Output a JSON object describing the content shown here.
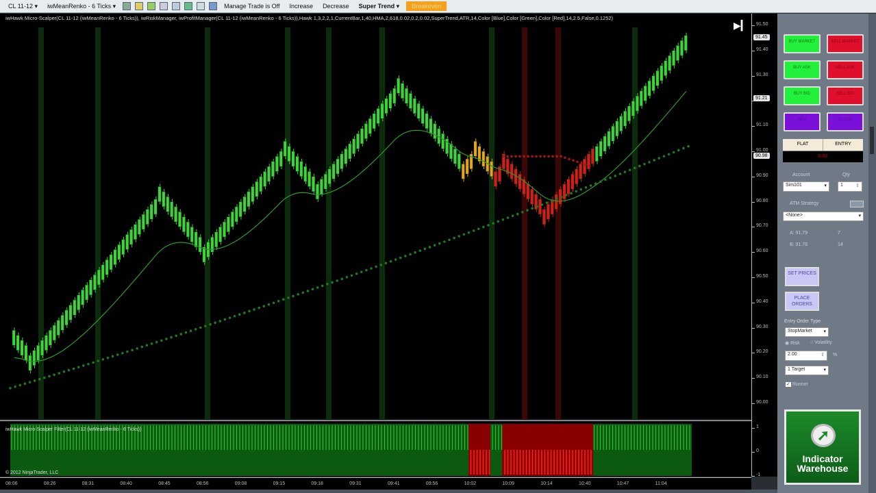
{
  "toolbar": {
    "instrument": "CL 11-12",
    "bar_type": "iwMeanRenko - 6 Ticks",
    "manage_trade": "Manage Trade is Off",
    "increase": "Increase",
    "decrease": "Decrease",
    "strategy": "Super Trend",
    "highlight": "Breakeven"
  },
  "chart": {
    "title": "iwHawk Micro-Scalper(CL 11-12 (iwMeanRenko - 6 Ticks)), iwRiskManager, iwProfitManager(CL 11-12 (iwMeanRenko - 6 Ticks)),Hawk 1,3,2,2,1,CurrentBar,1,40,HMA,2,618,0.02,0.2,0.02,SuperTrend,ATR,14,Color [Blue],Color [Green],Color [Red],14,2.5,False,0.1252)",
    "price_ticks": [
      "91.50",
      "91.40",
      "91.30",
      "91.20",
      "91.10",
      "91.00",
      "90.90",
      "90.80",
      "90.70",
      "90.60",
      "90.50",
      "90.40",
      "90.30",
      "90.20",
      "90.10",
      "90.00"
    ],
    "price_tags": [
      "91.45",
      "91.21",
      "90.98"
    ],
    "lower_ticks": [
      "1",
      "0",
      "-1"
    ]
  },
  "chart_data": {
    "type": "renko",
    "ylim": [
      90.0,
      91.5
    ],
    "brick_step": 0.02,
    "brick_size": 0.06,
    "pivots": [
      90.25,
      90.17,
      90.82,
      90.6,
      91.0,
      90.85,
      91.25,
      90.93,
      91.0,
      90.9,
      90.95,
      90.75,
      91.0,
      91.45
    ],
    "segment_colors": [
      "#3fd43a",
      "#3fd43a",
      "#3fd43a",
      "#3fd43a",
      "#3fd43a",
      "#3fd43a",
      "#3fd43a",
      "#e8a21f",
      "#e8a21f",
      "#e01818",
      "#e01818",
      "#e01818",
      "#3fd43a"
    ],
    "supertrend_start": 90.06,
    "supertrend_end": 91.02,
    "filter": [
      "g",
      "g",
      "g",
      "g",
      "g",
      "g",
      "g",
      "g",
      "g",
      "g",
      "g",
      "g",
      "g",
      "g",
      "g",
      "g",
      "g",
      "g",
      "g",
      "g",
      "g",
      "g",
      "g",
      "g",
      "g",
      "g",
      "g",
      "g",
      "g",
      "g",
      "g",
      "g",
      "g",
      "g",
      "g",
      "g",
      "g",
      "g",
      "g",
      "g",
      "g",
      "g",
      "g",
      "g",
      "g",
      "g",
      "g",
      "g",
      "g",
      "g",
      "g",
      "g",
      "g",
      "g",
      "g",
      "g",
      "g",
      "g",
      "g",
      "g",
      "g",
      "g",
      "g",
      "g",
      "g",
      "g",
      "g",
      "g",
      "g",
      "g",
      "g",
      "g",
      "g",
      "g",
      "g",
      "g",
      "g",
      "g",
      "g",
      "g",
      "g",
      "g",
      "g",
      "g",
      "g",
      "g",
      "g",
      "g",
      "g",
      "g",
      "g",
      "g",
      "g",
      "g",
      "g",
      "g",
      "g",
      "g",
      "g",
      "g",
      "g",
      "g",
      "g",
      "g",
      "g",
      "g",
      "g",
      "g",
      "g",
      "g",
      "g",
      "g",
      "g",
      "g",
      "g",
      "g",
      "g",
      "g",
      "g",
      "g",
      "g",
      "g",
      "g",
      "g",
      "g",
      "g",
      "g",
      "g",
      "g",
      "g",
      "g",
      "g",
      "g",
      "g",
      "g",
      "g",
      "g",
      "g",
      "g",
      "g",
      "g",
      "g",
      "g",
      "g",
      "g",
      "g",
      "g",
      "g",
      "g",
      "g",
      "g",
      "g",
      "g",
      "g",
      "g",
      "g",
      "g",
      "g",
      "g",
      "g",
      "g",
      "g",
      "g",
      "g",
      "g",
      "g",
      "g",
      "g",
      "g"
    ],
    "times": [
      "08:06",
      "08:26",
      "08:31",
      "08:40",
      "08:45",
      "08:56",
      "09:08",
      "09:15",
      "09:18",
      "09:31",
      "09:41",
      "09:56",
      "10:02",
      "10:09",
      "10:14",
      "10:40",
      "10:47",
      "11:04"
    ]
  },
  "lower": {
    "title": "iwHawk Micro-Scalper Filter(CL 11-12 (iwMeanRenko - 6 Ticks))",
    "copyright": "© 2012 NinjaTrader, LLC"
  },
  "panel": {
    "buy_market": "BUY MARKET",
    "sell_market": "SELL MARKET",
    "buy_ask": "BUY ASK",
    "sell_ask": "SELL ASK",
    "buy_bid": "BUY BID",
    "sell_bid": "SELL BID",
    "rev": "REV",
    "close": "CLOSE",
    "flat": "FLAT",
    "entry": "ENTRY",
    "pnl": "0.00",
    "account_label": "Account",
    "qty_label": "Qty",
    "account": "Sim101",
    "qty": "1",
    "atm_label": "ATM Strategy",
    "atm": "<None>",
    "ask": "A: 91.79",
    "ask_size": "7",
    "bid": "B: 91.78",
    "bid_size": "14",
    "set_prices": "SET PRICES",
    "place_orders": "PLACE ORDERS",
    "entry_type_label": "Entry Order Type",
    "entry_type": "StopMarket",
    "risk": "Risk",
    "volatility": "Volatility",
    "pct_value": "2.00",
    "pct": "%",
    "target": "1 Target",
    "runner": "Runner"
  },
  "logo": {
    "line1": "Indicator",
    "line2": "Warehouse"
  }
}
